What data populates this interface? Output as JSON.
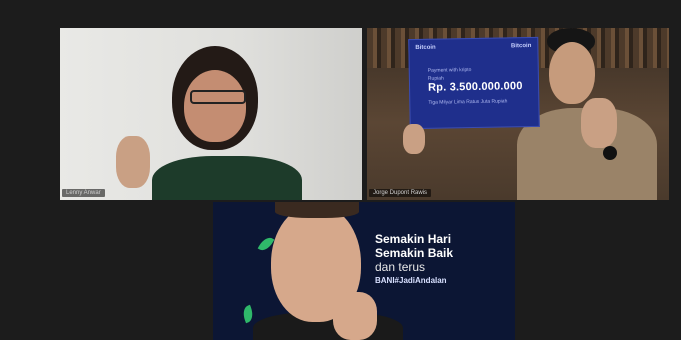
{
  "participants": [
    {
      "name": "Lenny Anwar"
    },
    {
      "name": "Jorge Dupont Rawis"
    },
    {
      "name": ""
    }
  ],
  "check": {
    "brand_left": "Bitcoin",
    "brand_right": "Bitcoin",
    "line1": "Payment with kripto",
    "amount_label": "Rupiah",
    "amount": "Rp. 3.500.000.000",
    "line2": "Tiga Milyar Lima Ratus Juta Rupiah"
  },
  "banner": {
    "line1": "Semakin Hari",
    "line2": "Semakin Baik",
    "line3": "dan terus",
    "line4": "BANI#JadiAndalan"
  },
  "colors": {
    "background": "#1c1c1c",
    "check": "#1f2f8c",
    "banner_bg": "#0c1634",
    "accent_green": "#2fb86a"
  }
}
